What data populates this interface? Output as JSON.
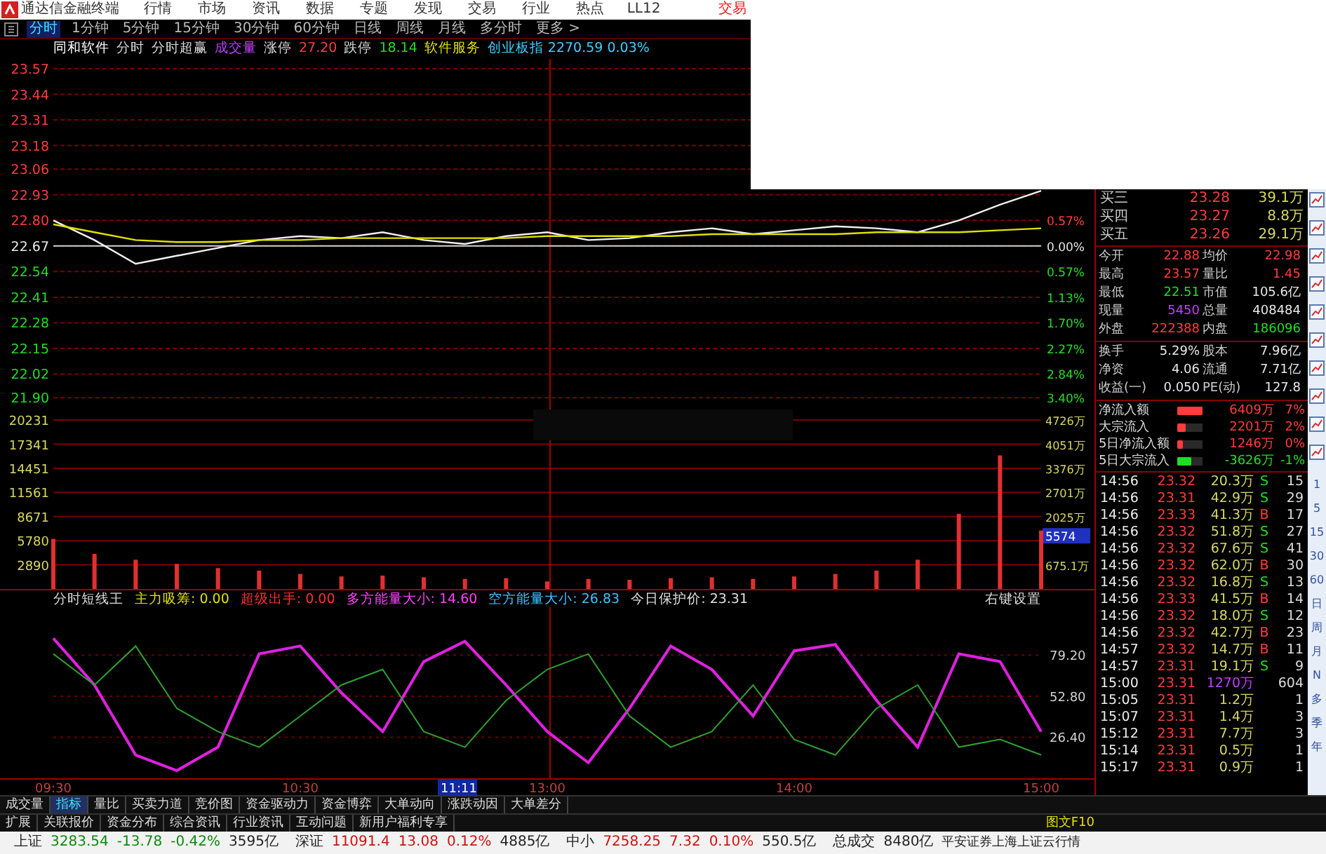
{
  "menu_bar": {
    "title": "通达信金融终端",
    "items": [
      "行情",
      "市场",
      "资讯",
      "数据",
      "专题",
      "发现",
      "交易",
      "行业",
      "热点",
      "LL12"
    ],
    "trade_button": "交易"
  },
  "period_tabs": [
    {
      "label": "分时",
      "selected": true
    },
    {
      "label": "1分钟",
      "selected": false
    },
    {
      "label": "5分钟",
      "selected": false
    },
    {
      "label": "15分钟",
      "selected": false
    },
    {
      "label": "30分钟",
      "selected": false
    },
    {
      "label": "60分钟",
      "selected": false
    },
    {
      "label": "日线",
      "selected": false
    },
    {
      "label": "周线",
      "selected": false
    },
    {
      "label": "月线",
      "selected": false
    },
    {
      "label": "多分时",
      "selected": false
    },
    {
      "label": "更多 >",
      "selected": false
    }
  ],
  "info_line": [
    {
      "text": "同和软件",
      "kind": "name"
    },
    {
      "text": "分时",
      "kind": "plain"
    },
    {
      "text": "分时超赢",
      "kind": "plain"
    },
    {
      "text": "成交量",
      "kind": "volume"
    },
    {
      "text": "涨停",
      "kind": "plain"
    },
    {
      "text": "27.20",
      "kind": "up"
    },
    {
      "text": "跌停",
      "kind": "plain"
    },
    {
      "text": "18.14",
      "kind": "down"
    },
    {
      "text": "软件服务",
      "kind": "sector"
    },
    {
      "text": "创业板指 2270.59 0.03%",
      "kind": "index"
    }
  ],
  "price_chart": {
    "chart_data": {
      "type": "line",
      "ylim": [
        21.84,
        23.62
      ],
      "grid": true,
      "yticks": [
        {
          "value": 21.9,
          "label": "21.90"
        },
        {
          "value": 22.02,
          "label": "22.02"
        },
        {
          "value": 22.15,
          "label": "22.15"
        },
        {
          "value": 22.28,
          "label": "22.28"
        },
        {
          "value": 22.41,
          "label": "22.41"
        },
        {
          "value": 22.54,
          "label": "22.54"
        },
        {
          "value": 22.67,
          "label": "22.67"
        },
        {
          "value": 22.8,
          "label": "22.80"
        },
        {
          "value": 22.93,
          "label": "22.93"
        },
        {
          "value": 23.06,
          "label": "23.06"
        },
        {
          "value": 23.18,
          "label": "23.18"
        },
        {
          "value": 23.31,
          "label": "23.31"
        },
        {
          "value": 23.44,
          "label": "23.44"
        },
        {
          "value": 23.57,
          "label": "23.57"
        }
      ],
      "series": [
        {
          "color": "#f0f0f0",
          "values": [
            22.8,
            22.7,
            22.58,
            22.62,
            22.66,
            22.7,
            22.72,
            22.71,
            22.74,
            22.7,
            22.68,
            22.72,
            22.74,
            22.7,
            22.71,
            22.74,
            22.76,
            22.73,
            22.75,
            22.77,
            22.76,
            22.74,
            22.8,
            22.88,
            22.95
          ]
        },
        {
          "color": "#e0e000",
          "values": [
            22.78,
            22.74,
            22.7,
            22.69,
            22.69,
            22.7,
            22.7,
            22.71,
            22.71,
            22.71,
            22.71,
            22.71,
            22.72,
            22.72,
            22.72,
            22.72,
            22.73,
            22.73,
            22.73,
            22.73,
            22.74,
            22.74,
            22.74,
            22.75,
            22.76
          ]
        }
      ],
      "ref_lines": [
        {
          "axis": "y",
          "value": 22.67
        }
      ]
    },
    "right_axis": [
      {
        "text": "0.57%",
        "kind": "up"
      },
      {
        "text": "0.00%",
        "kind": "flat"
      },
      {
        "text": "0.57%",
        "kind": "down"
      },
      {
        "text": "1.13%",
        "kind": "down"
      },
      {
        "text": "1.70%",
        "kind": "down"
      },
      {
        "text": "2.27%",
        "kind": "down"
      },
      {
        "text": "2.84%",
        "kind": "down"
      },
      {
        "text": "3.40%",
        "kind": "down"
      }
    ]
  },
  "volume_chart": {
    "chart_data": {
      "type": "bar",
      "ylim": [
        0,
        21500
      ],
      "grid": true,
      "yticks": [
        2890,
        5780,
        8671,
        11561,
        14451,
        17341,
        20231
      ],
      "series": [
        {
          "color": "#e03030",
          "values": [
            6000,
            4200,
            3500,
            3000,
            2500,
            2200,
            1800,
            1500,
            1600,
            1400,
            1200,
            1300,
            900,
            1200,
            1100,
            1300,
            1400,
            1200,
            1500,
            1800,
            2200,
            3500,
            9000,
            16000,
            7000
          ]
        }
      ]
    },
    "right_axis": [
      {
        "text": "4726万",
        "kind": "amount"
      },
      {
        "text": "4051万",
        "kind": "amount"
      },
      {
        "text": "3376万",
        "kind": "amount"
      },
      {
        "text": "2701万",
        "kind": "amount"
      },
      {
        "text": "2025万",
        "kind": "amount"
      },
      {
        "text": "5574",
        "kind": "cursor"
      },
      {
        "text": "675.1万",
        "kind": "amount"
      }
    ]
  },
  "indicator": {
    "title": "分时短线王",
    "items": [
      {
        "label": "主力吸筹:",
        "value": "0.00",
        "color": "#e0e000"
      },
      {
        "label": "超级出手:",
        "value": "0.00",
        "color": "#ff3030"
      },
      {
        "label": "多方能量大小:",
        "value": "14.60",
        "color": "#ff40ff"
      },
      {
        "label": "空方能量大小:",
        "value": "26.83",
        "color": "#40c0ff"
      },
      {
        "label": "今日保护价:",
        "value": "23.31",
        "color": "#e0e0e0"
      }
    ],
    "settings": "右键设置",
    "chart_data": {
      "type": "line",
      "categories": [
        "09:30",
        null,
        null,
        null,
        null,
        null,
        "10:30",
        null,
        null,
        null,
        null,
        null,
        "13:00",
        null,
        null,
        null,
        null,
        null,
        "14:00",
        null,
        null,
        null,
        null,
        null,
        "15:00"
      ],
      "ylim": [
        0,
        110
      ],
      "grid": true,
      "yticks": [
        {
          "value": 26.4,
          "label": "26.40"
        },
        {
          "value": 52.8,
          "label": "52.80"
        },
        {
          "value": 79.2,
          "label": "79.20"
        }
      ],
      "series": [
        {
          "color": "#e020e0",
          "values": [
            90,
            60,
            15,
            5,
            20,
            80,
            85,
            55,
            30,
            75,
            88,
            60,
            30,
            10,
            45,
            85,
            70,
            40,
            82,
            86,
            50,
            20,
            80,
            75,
            30
          ]
        },
        {
          "color": "#30a030",
          "values": [
            80,
            60,
            85,
            45,
            30,
            20,
            40,
            60,
            70,
            30,
            20,
            50,
            70,
            80,
            40,
            20,
            30,
            60,
            25,
            15,
            45,
            60,
            20,
            25,
            15
          ]
        }
      ]
    }
  },
  "time_axis": {
    "cursor": "11:11"
  },
  "quote_panel": {
    "order_book": [
      {
        "label": "买三",
        "price": "23.28",
        "volume": "39.1万"
      },
      {
        "label": "买四",
        "price": "23.27",
        "volume": "8.8万"
      },
      {
        "label": "买五",
        "price": "23.26",
        "volume": "29.1万"
      }
    ],
    "stats": [
      {
        "left": {
          "label": "今开",
          "value": "22.88",
          "kind": "up"
        },
        "right": {
          "label": "均价",
          "value": "22.98",
          "kind": "up"
        }
      },
      {
        "left": {
          "label": "最高",
          "value": "23.57",
          "kind": "up"
        },
        "right": {
          "label": "量比",
          "value": "1.45",
          "kind": "up"
        }
      },
      {
        "left": {
          "label": "最低",
          "value": "22.51",
          "kind": "down"
        },
        "right": {
          "label": "市值",
          "value": "105.6亿",
          "kind": "flat"
        }
      },
      {
        "left": {
          "label": "现量",
          "value": "5450",
          "kind": "volume"
        },
        "right": {
          "label": "总量",
          "value": "408484",
          "kind": "flat"
        }
      },
      {
        "left": {
          "label": "外盘",
          "value": "222388",
          "kind": "up"
        },
        "right": {
          "label": "内盘",
          "value": "186096",
          "kind": "down"
        }
      },
      {
        "left": {
          "label": "换手",
          "value": "5.29%",
          "kind": "flat"
        },
        "right": {
          "label": "股本",
          "value": "7.96亿",
          "kind": "flat"
        }
      },
      {
        "left": {
          "label": "净资",
          "value": "4.06",
          "kind": "flat"
        },
        "right": {
          "label": "流通",
          "value": "7.71亿",
          "kind": "flat"
        }
      },
      {
        "left": {
          "label": "收益(一)",
          "value": "0.050",
          "kind": "flat"
        },
        "right": {
          "label": "PE(动)",
          "value": "127.8",
          "kind": "flat"
        }
      }
    ],
    "fund_flows": [
      {
        "label": "净流入额",
        "value": "6409万",
        "pct": "7%",
        "level": 1,
        "kind": "up"
      },
      {
        "label": "大宗流入",
        "value": "2201万",
        "pct": "2%",
        "level": 0.35,
        "kind": "up"
      },
      {
        "label": "5日净流入额",
        "value": "1246万",
        "pct": "0%",
        "level": 0.2,
        "kind": "up"
      },
      {
        "label": "5日大宗流入",
        "value": "-3626万",
        "pct": "-1%",
        "level": 0.55,
        "kind": "down"
      }
    ],
    "trades": [
      {
        "time": "14:56",
        "price": "23.32",
        "volume": "20.3万",
        "side": "S",
        "kind": "sell",
        "count": "15"
      },
      {
        "time": "14:56",
        "price": "23.31",
        "volume": "42.9万",
        "side": "S",
        "kind": "sell",
        "count": "29"
      },
      {
        "time": "14:56",
        "price": "23.33",
        "volume": "41.3万",
        "side": "B",
        "kind": "buy",
        "count": "17"
      },
      {
        "time": "14:56",
        "price": "23.32",
        "volume": "51.8万",
        "side": "S",
        "kind": "sell",
        "count": "27"
      },
      {
        "time": "14:56",
        "price": "23.32",
        "volume": "67.6万",
        "side": "S",
        "kind": "sell",
        "count": "41"
      },
      {
        "time": "14:56",
        "price": "23.32",
        "volume": "62.0万",
        "side": "B",
        "kind": "buy",
        "count": "30"
      },
      {
        "time": "14:56",
        "price": "23.32",
        "volume": "16.8万",
        "side": "S",
        "kind": "sell",
        "count": "13"
      },
      {
        "time": "14:56",
        "price": "23.33",
        "volume": "41.5万",
        "side": "B",
        "kind": "buy",
        "count": "14"
      },
      {
        "time": "14:56",
        "price": "23.32",
        "volume": "18.0万",
        "side": "S",
        "kind": "sell",
        "count": "12"
      },
      {
        "time": "14:56",
        "price": "23.32",
        "volume": "42.7万",
        "side": "B",
        "kind": "buy",
        "count": "23"
      },
      {
        "time": "14:57",
        "price": "23.32",
        "volume": "14.7万",
        "side": "B",
        "kind": "buy",
        "count": "11"
      },
      {
        "time": "14:57",
        "price": "23.31",
        "volume": "19.1万",
        "side": "S",
        "kind": "sell",
        "count": "9"
      },
      {
        "time": "15:00",
        "price": "23.31",
        "volume": "1270万",
        "kind": "block",
        "count": "604"
      },
      {
        "time": "15:05",
        "price": "23.31",
        "volume": "1.2万",
        "kind": "after",
        "count": "1"
      },
      {
        "time": "15:07",
        "price": "23.31",
        "volume": "1.4万",
        "kind": "after",
        "count": "3"
      },
      {
        "time": "15:12",
        "price": "23.31",
        "volume": "7.7万",
        "kind": "after",
        "count": "3"
      },
      {
        "time": "15:14",
        "price": "23.31",
        "volume": "0.5万",
        "kind": "after",
        "count": "1"
      },
      {
        "time": "15:17",
        "price": "23.31",
        "volume": "0.9万",
        "kind": "after",
        "count": "1"
      }
    ]
  },
  "side_toolbar": {
    "periods": [
      "1",
      "5",
      "15",
      "30",
      "60",
      "日",
      "周",
      "月",
      "N",
      "多",
      "季",
      "年"
    ]
  },
  "bottom_tabs": {
    "row_1": [
      {
        "label": "成交量",
        "selected": false
      },
      {
        "label": "指标",
        "selected": true
      },
      {
        "label": "量比",
        "selected": false
      },
      {
        "label": "买卖力道",
        "selected": false
      },
      {
        "label": "竞价图",
        "selected": false
      },
      {
        "label": "资金驱动力",
        "selected": false
      },
      {
        "label": "资金博弈",
        "selected": false
      },
      {
        "label": "大单动向",
        "selected": false
      },
      {
        "label": "涨跌动因",
        "selected": false
      },
      {
        "label": "大单差分",
        "selected": false
      }
    ],
    "row_2": [
      {
        "label": "扩展",
        "selected": false
      },
      {
        "label": "关联报价",
        "selected": false
      },
      {
        "label": "资金分布",
        "selected": false
      },
      {
        "label": "综合资讯",
        "selected": false
      },
      {
        "label": "行业资讯",
        "selected": false
      },
      {
        "label": "互动问题",
        "selected": false
      },
      {
        "label": "新用户福利专享",
        "selected": false
      }
    ],
    "f10": "图文F10"
  },
  "status_bar": {
    "indices": [
      {
        "name": "上证",
        "value": "3283.54",
        "change": "-13.78",
        "pct": "-0.42%",
        "amount": "3595亿",
        "kind": "down"
      },
      {
        "name": "深证",
        "value": "11091.4",
        "change": "13.08",
        "pct": "0.12%",
        "amount": "4885亿",
        "kind": "up"
      },
      {
        "name": "中小",
        "value": "7258.25",
        "change": "7.32",
        "pct": "0.10%",
        "amount": "550.5亿",
        "kind": "up"
      }
    ],
    "total": {
      "label": "总成交",
      "value": "8480亿"
    },
    "broker": "平安证券上海上证云行情"
  }
}
